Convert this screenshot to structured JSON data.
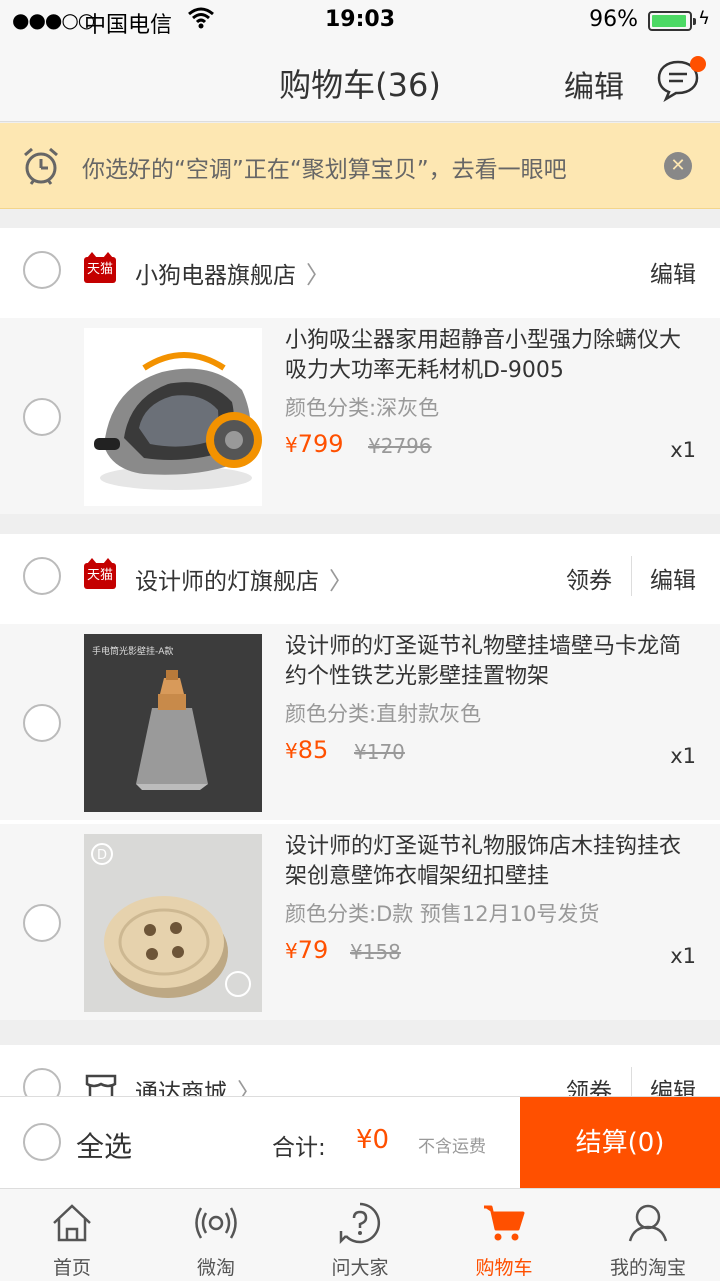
{
  "status": {
    "signal": "●●●○○",
    "carrier": "中国电信",
    "time": "19:03",
    "battery": "96%"
  },
  "nav": {
    "title": "购物车(36)",
    "edit": "编辑"
  },
  "notice": {
    "text": "你选好的“空调”正在“聚划算宝贝”，去看一眼吧"
  },
  "stores": [
    {
      "name": "小狗电器旗舰店",
      "edit": "编辑",
      "items": [
        {
          "title": "小狗吸尘器家用超静音小型强力除螨仪大吸力大功率无耗材机D-9005",
          "spec": "颜色分类:深灰色",
          "currency": "¥",
          "price": "799",
          "orig": "¥2796",
          "qty": "x1"
        }
      ]
    },
    {
      "name": "设计师的灯旗舰店",
      "coupon": "领券",
      "edit": "编辑",
      "items": [
        {
          "title": "设计师的灯圣诞节礼物壁挂墙壁马卡龙简约个性铁艺光影壁挂置物架",
          "spec": "颜色分类:直射款灰色",
          "currency": "¥",
          "price": "85",
          "orig": "¥170",
          "qty": "x1",
          "thumb_caption": "手电筒光影壁挂-A款"
        },
        {
          "title": "设计师的灯圣诞节礼物服饰店木挂钩挂衣架创意壁饰衣帽架纽扣壁挂",
          "spec": "颜色分类:D款 预售12月10号发货",
          "currency": "¥",
          "price": "79",
          "orig": "¥158",
          "qty": "x1",
          "thumb_caption": "D"
        }
      ]
    },
    {
      "name": "通达商城",
      "coupon": "领券",
      "edit": "编辑"
    }
  ],
  "bottom": {
    "select_all": "全选",
    "total_label": "合计:",
    "total": "¥0",
    "freight": "不含运费",
    "checkout": "结算(0)"
  },
  "tabs": [
    {
      "label": "首页",
      "icon": "home-icon"
    },
    {
      "label": "微淘",
      "icon": "broadcast-icon"
    },
    {
      "label": "问大家",
      "icon": "question-icon"
    },
    {
      "label": "购物车",
      "icon": "cart-icon",
      "active": true
    },
    {
      "label": "我的淘宝",
      "icon": "profile-icon"
    }
  ],
  "colors": {
    "accent": "#ff5000",
    "notice_bg": "#fde7b2",
    "tmall": "#c40000"
  }
}
